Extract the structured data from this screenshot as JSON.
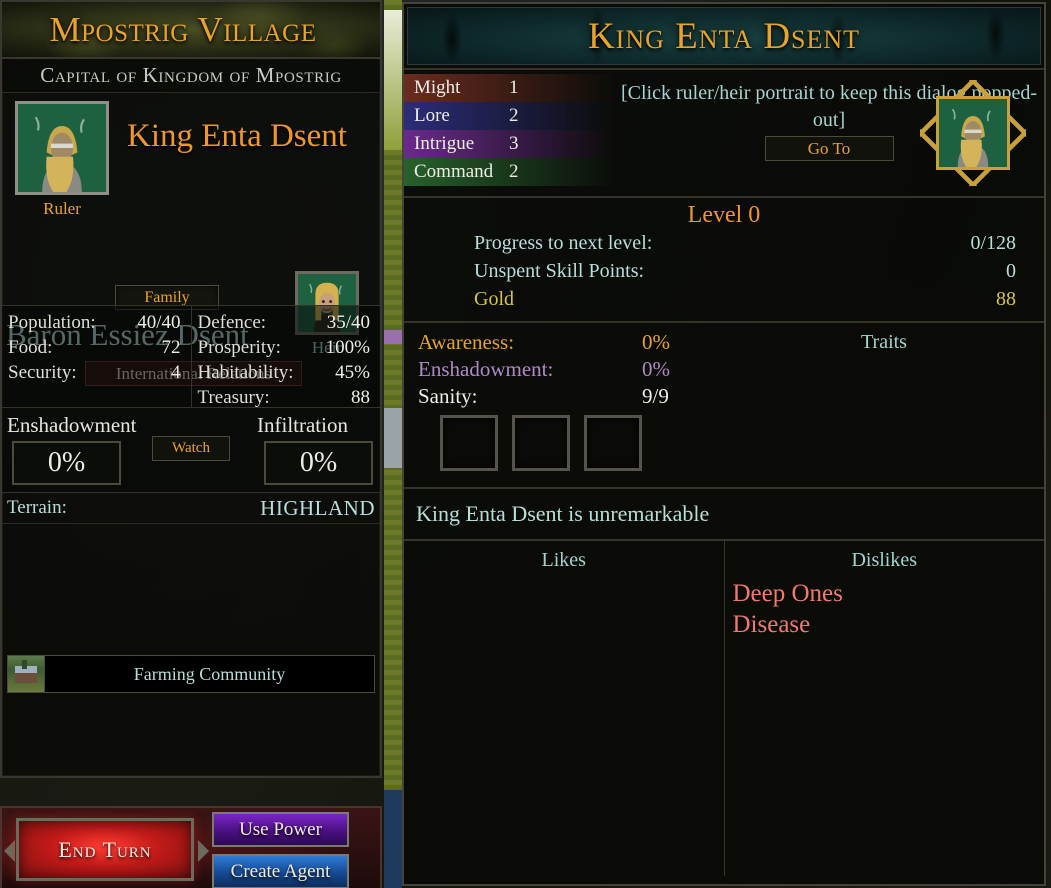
{
  "left_panel": {
    "title": "Mpostrig Village",
    "subtitle": "Capital of Kingdom of Mpostrig",
    "ruler_caption": "Ruler",
    "ruler_name": "King Enta Dsent",
    "family_button": "Family",
    "heir_name": "Baron Essiez Dsent",
    "heir_caption": "Heir",
    "international_relations_button": "International Relations",
    "stats_left": [
      {
        "label": "Population:",
        "value": "40/40"
      },
      {
        "label": "Food:",
        "value": "72"
      },
      {
        "label": "Security:",
        "value": "4"
      }
    ],
    "stats_right": [
      {
        "label": "Defence:",
        "value": "35/40"
      },
      {
        "label": "Prosperity:",
        "value": "100%"
      },
      {
        "label": "Habitability:",
        "value": "45%"
      },
      {
        "label": "Treasury:",
        "value": "88"
      }
    ],
    "enshadowment_label": "Enshadowment",
    "enshadowment_value": "0%",
    "watch_button": "Watch",
    "infiltration_label": "Infiltration",
    "infiltration_value": "0%",
    "terrain_label": "Terrain:",
    "terrain_value": "HIGHLAND",
    "building": "Farming Community",
    "end_turn_button": "End Turn",
    "use_power_button": "Use Power",
    "create_agent_button": "Create Agent"
  },
  "right_panel": {
    "title": "King Enta Dsent",
    "attributes": [
      {
        "name": "Might",
        "value": "1",
        "color": "#6b2b20"
      },
      {
        "name": "Lore",
        "value": "2",
        "color": "#2c2c7a"
      },
      {
        "name": "Intrigue",
        "value": "3",
        "color": "#6a2a8c"
      },
      {
        "name": "Command",
        "value": "2",
        "color": "#27612c"
      }
    ],
    "dialog_note": "[Click ruler/heir portrait to keep this dialog popped-out]",
    "goto_button": "Go To",
    "level_title": "Level 0",
    "level_rows": [
      {
        "key": "Progress to next level:",
        "value": "0/128"
      },
      {
        "key": "Unspent Skill Points:",
        "value": "0"
      },
      {
        "key": "Gold",
        "value": "88"
      }
    ],
    "awareness_label": "Awareness:",
    "awareness_value": "0%",
    "enshadowment_label": "Enshadowment:",
    "enshadowment_value": "0%",
    "sanity_label": "Sanity:",
    "sanity_value": "9/9",
    "traits_label": "Traits",
    "description": "King Enta Dsent is unremarkable",
    "likes_label": "Likes",
    "likes": [],
    "dislikes_label": "Dislikes",
    "dislikes": [
      "Deep Ones",
      "Disease"
    ]
  }
}
